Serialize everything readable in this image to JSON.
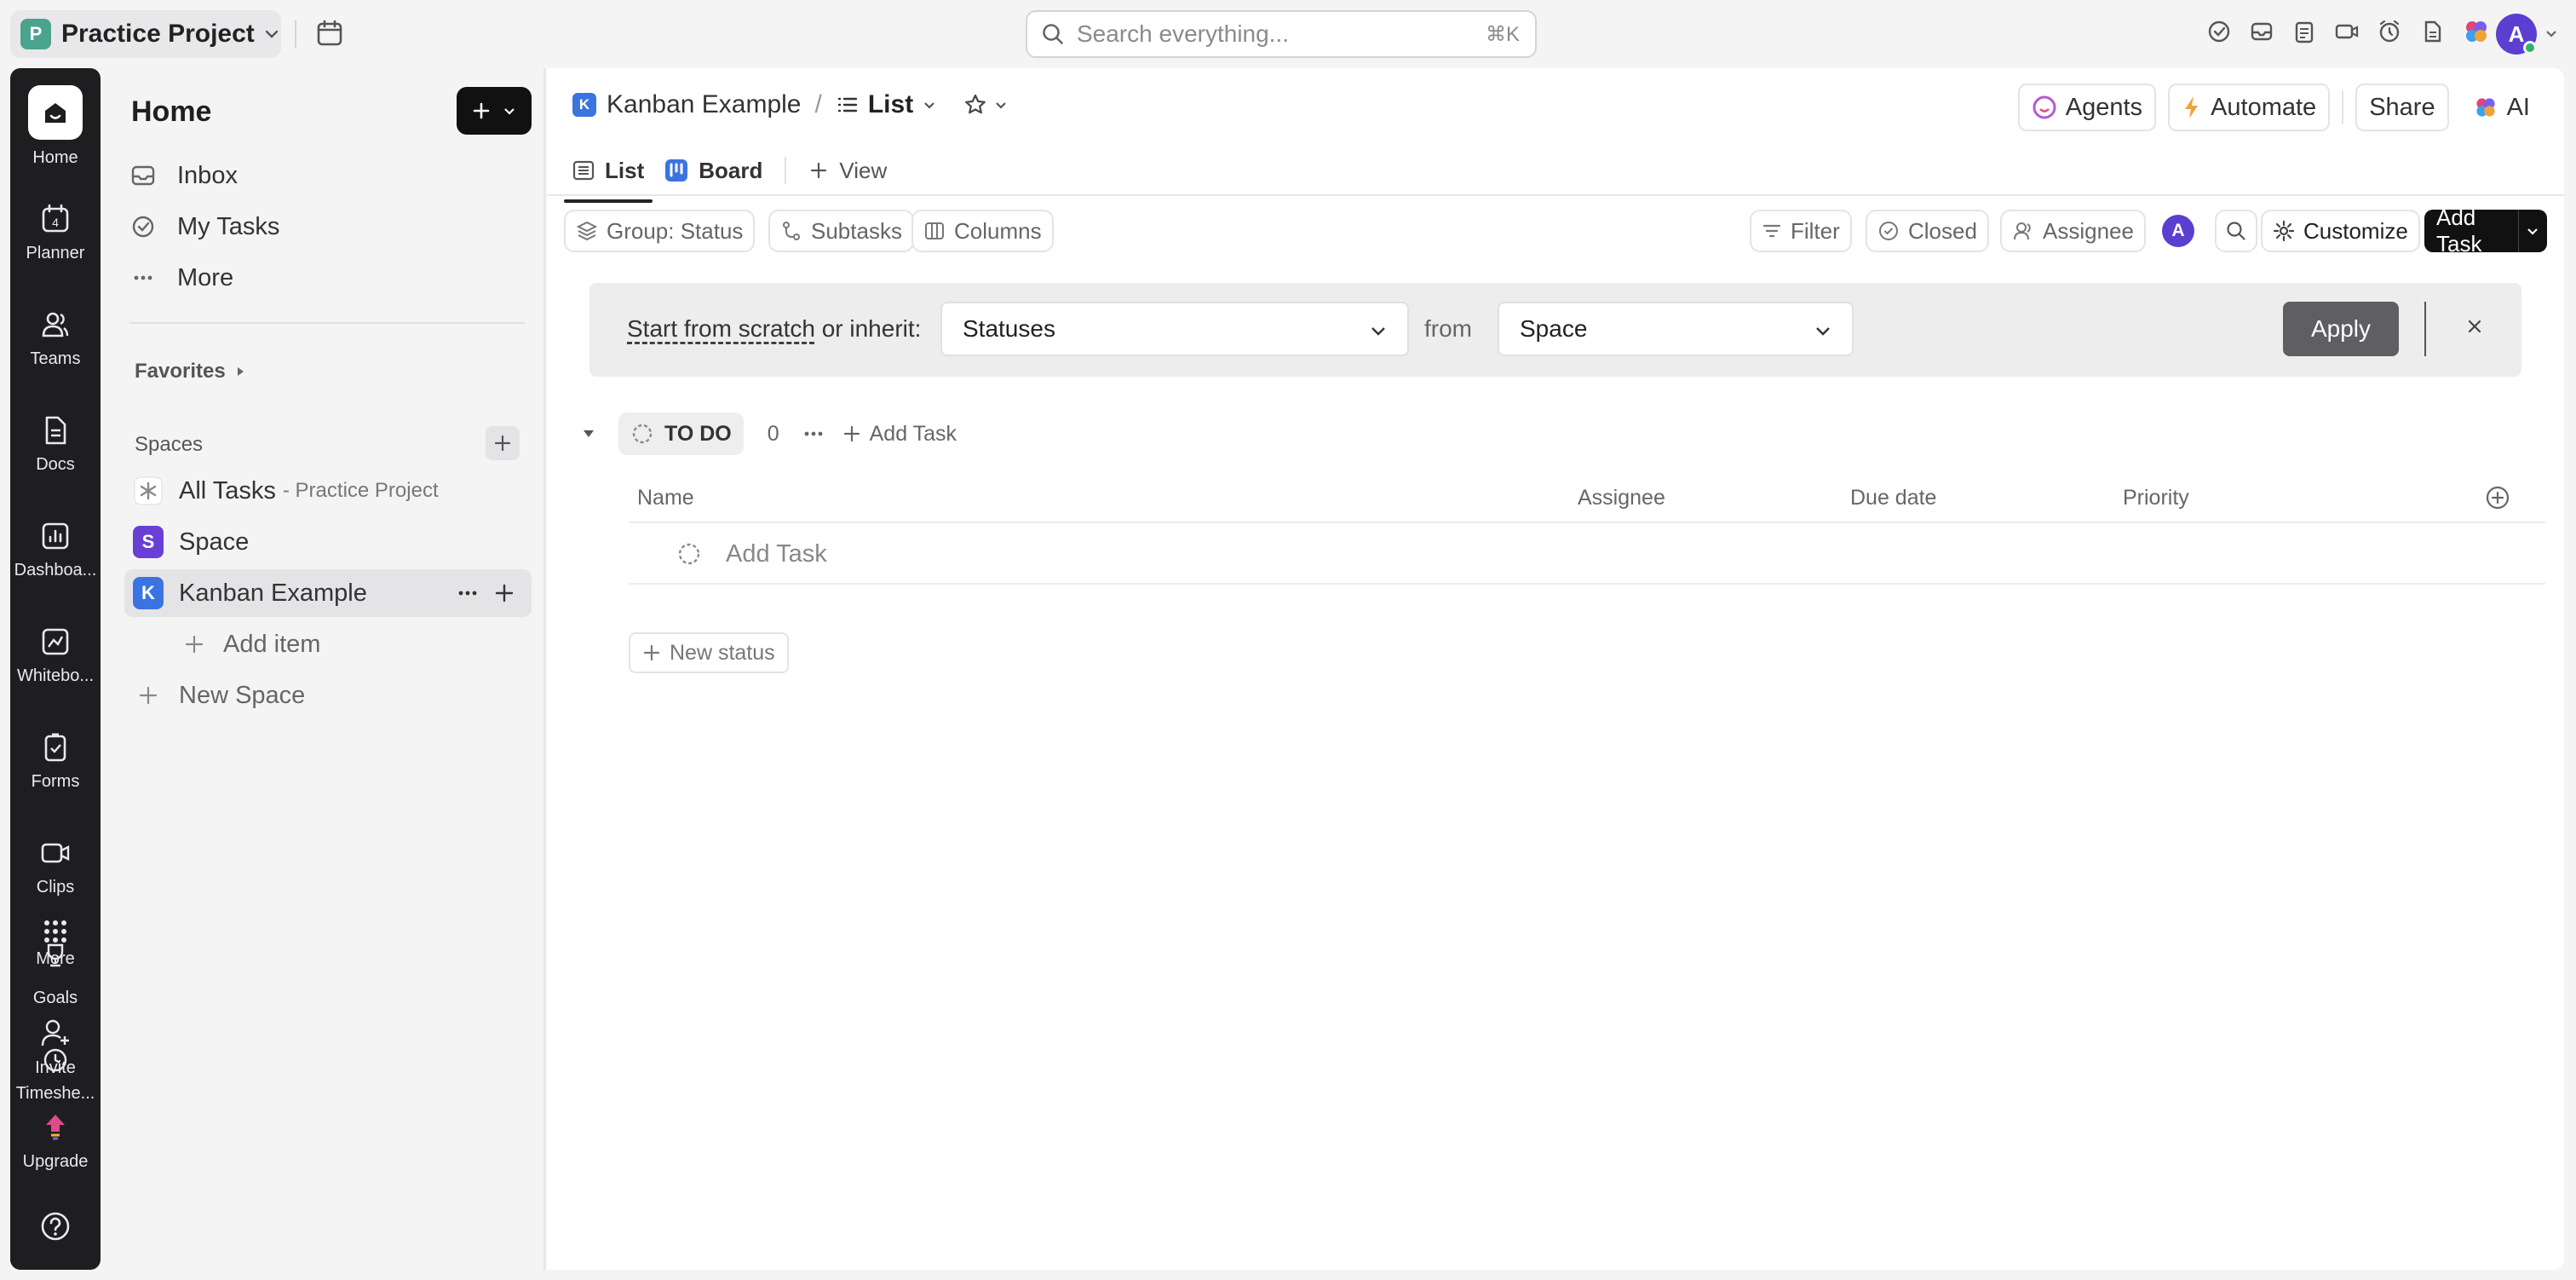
{
  "topbar": {
    "workspace_initial": "P",
    "workspace_name": "Practice Project",
    "search_placeholder": "Search everything...",
    "search_shortcut": "⌘K",
    "avatar_initial": "A"
  },
  "rail": {
    "items": [
      {
        "label": "Home",
        "icon": "home-icon"
      },
      {
        "label": "Planner",
        "icon": "calendar-icon"
      },
      {
        "label": "Teams",
        "icon": "teams-icon"
      },
      {
        "label": "Docs",
        "icon": "docs-icon"
      },
      {
        "label": "Dashboa...",
        "icon": "dashboard-icon"
      },
      {
        "label": "Whitebo...",
        "icon": "whiteboard-icon"
      },
      {
        "label": "Forms",
        "icon": "forms-icon"
      },
      {
        "label": "Clips",
        "icon": "clips-icon"
      },
      {
        "label": "More",
        "icon": "grid-icon"
      },
      {
        "label": "Goals",
        "icon": "goals-icon"
      },
      {
        "label": "Invite",
        "icon": "invite-icon"
      },
      {
        "label": "Timeshe...",
        "icon": "clock-icon"
      },
      {
        "label": "Upgrade",
        "icon": "upgrade-icon"
      }
    ],
    "planner_day": "4"
  },
  "sidebar": {
    "title": "Home",
    "nav": [
      {
        "label": "Inbox",
        "icon": "inbox-icon"
      },
      {
        "label": "My Tasks",
        "icon": "check-circle-icon"
      },
      {
        "label": "More",
        "icon": "ellipsis-icon"
      }
    ],
    "favorites_label": "Favorites",
    "spaces_label": "Spaces",
    "all_tasks_label": "All Tasks",
    "all_tasks_sub": "- Practice Project",
    "spaces": [
      {
        "initial": "S",
        "label": "Space",
        "color": "#6a3fd6"
      },
      {
        "initial": "K",
        "label": "Kanban Example",
        "color": "#3b74e0"
      }
    ],
    "add_item_label": "Add item",
    "new_space_label": "New Space"
  },
  "header": {
    "crumb_initial": "K",
    "crumb_space": "Kanban Example",
    "crumb_sep": "/",
    "crumb_view": "List",
    "agents_label": "Agents",
    "automate_label": "Automate",
    "share_label": "Share",
    "ai_label": "AI"
  },
  "tabs": [
    {
      "label": "List",
      "active": true
    },
    {
      "label": "Board",
      "active": false
    }
  ],
  "add_view_label": "View",
  "toolbar": {
    "group_label": "Group: Status",
    "subtasks_label": "Subtasks",
    "columns_label": "Columns",
    "filter_label": "Filter",
    "closed_label": "Closed",
    "assignee_label": "Assignee",
    "avatar_initial": "A",
    "customize_label": "Customize",
    "add_task_label": "Add Task"
  },
  "inherit_bar": {
    "link_text": "Start from scratch",
    "rest_text": " or inherit:",
    "statuses_value": "Statuses",
    "from_label": "from",
    "space_value": "Space",
    "apply_label": "Apply"
  },
  "group": {
    "status_label": "TO DO",
    "count": "0",
    "add_task_label": "Add Task"
  },
  "table": {
    "columns": [
      "Name",
      "Assignee",
      "Due date",
      "Priority"
    ],
    "add_task_placeholder": "Add Task"
  },
  "new_status_label": "New status",
  "colors": {
    "accent_dark": "#111111",
    "rail_bg": "#1e1e21",
    "workspace_badge": "#4aa38c",
    "avatar": "#5b3fd0",
    "online": "#2fb36b"
  }
}
